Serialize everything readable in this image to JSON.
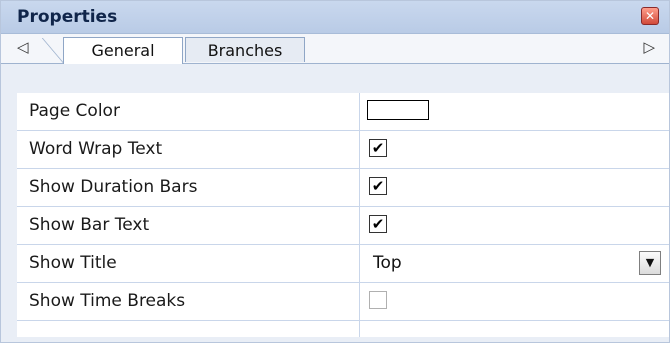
{
  "panel": {
    "title": "Properties"
  },
  "tabs": {
    "left_arrow": "◁",
    "right_arrow": "▷",
    "items": [
      {
        "label": "General",
        "active": true
      },
      {
        "label": "Branches",
        "active": false
      }
    ]
  },
  "properties": [
    {
      "name": "Page Color",
      "type": "color",
      "value": "#ffffff"
    },
    {
      "name": "Word Wrap Text",
      "type": "checkbox",
      "checked": true
    },
    {
      "name": "Show Duration Bars",
      "type": "checkbox",
      "checked": true
    },
    {
      "name": "Show Bar Text",
      "type": "checkbox",
      "checked": true
    },
    {
      "name": "Show Title",
      "type": "select",
      "value": "Top"
    },
    {
      "name": "Show Time Breaks",
      "type": "checkbox",
      "checked": false
    }
  ],
  "glyphs": {
    "check": "✔",
    "close": "✕",
    "dropdown": "▼"
  },
  "colors": {
    "title_bar": "#c2d3ec",
    "grid_line": "#c9d6ea"
  }
}
